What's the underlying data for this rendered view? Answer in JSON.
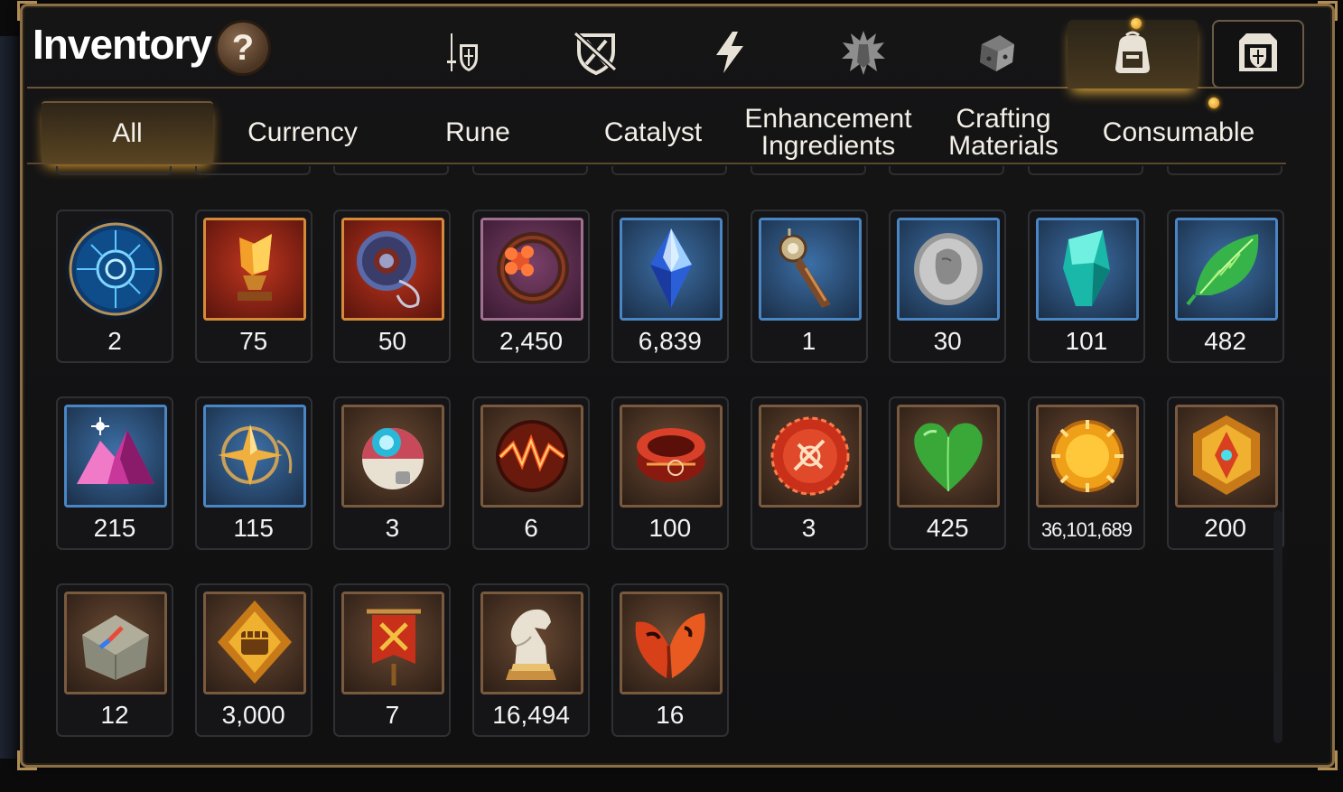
{
  "title": "Inventory",
  "help_label": "?",
  "top_tabs": [
    {
      "name": "tab-equipment",
      "icon": "sword-shield-icon",
      "active": false
    },
    {
      "name": "tab-artifact",
      "icon": "crossed-shield-icon",
      "active": false
    },
    {
      "name": "tab-skill",
      "icon": "lightning-icon",
      "active": false
    },
    {
      "name": "tab-catalyst",
      "icon": "spiky-crest-icon",
      "active": false
    },
    {
      "name": "tab-crafting",
      "icon": "dice-icon",
      "active": false
    },
    {
      "name": "tab-inventory",
      "icon": "backpack-icon",
      "active": true
    },
    {
      "name": "tab-guild",
      "icon": "castle-shield-icon",
      "active": false
    }
  ],
  "categories": [
    {
      "label": "All",
      "lines": [
        "All"
      ],
      "active": true
    },
    {
      "label": "Currency",
      "lines": [
        "Currency"
      ],
      "active": false
    },
    {
      "label": "Rune",
      "lines": [
        "Rune"
      ],
      "active": false
    },
    {
      "label": "Catalyst",
      "lines": [
        "Catalyst"
      ],
      "active": false
    },
    {
      "label": "Enhancement Ingredients",
      "lines": [
        "Enhancement",
        "Ingredients"
      ],
      "active": false
    },
    {
      "label": "Crafting Materials",
      "lines": [
        "Crafting",
        "Materials"
      ],
      "active": false
    },
    {
      "label": "Consumable",
      "lines": [
        "Consumable"
      ],
      "active": false
    }
  ],
  "items": [
    {
      "icon": "blue-rune-orb-icon",
      "qty": "2"
    },
    {
      "icon": "golden-crystal-trophy-icon",
      "qty": "75"
    },
    {
      "icon": "blue-ring-pendant-icon",
      "qty": "50"
    },
    {
      "icon": "red-flower-ring-icon",
      "qty": "2,450"
    },
    {
      "icon": "blue-crystal-icon",
      "qty": "6,839"
    },
    {
      "icon": "compass-pendulum-icon",
      "qty": "1"
    },
    {
      "icon": "silver-coin-icon",
      "qty": "30"
    },
    {
      "icon": "teal-crystal-icon",
      "qty": "101"
    },
    {
      "icon": "green-leaf-icon",
      "qty": "482"
    },
    {
      "icon": "pink-crystal-pile-icon",
      "qty": "215"
    },
    {
      "icon": "star-amulet-icon",
      "qty": "115"
    },
    {
      "icon": "robot-capsule-icon",
      "qty": "3"
    },
    {
      "icon": "red-energy-orb-icon",
      "qty": "6"
    },
    {
      "icon": "red-bracelet-icon",
      "qty": "100"
    },
    {
      "icon": "red-seal-badge-icon",
      "qty": "3"
    },
    {
      "icon": "green-heart-icon",
      "qty": "425"
    },
    {
      "icon": "gold-coin-icon",
      "qty": "36,101,689"
    },
    {
      "icon": "gold-emblem-icon",
      "qty": "200"
    },
    {
      "icon": "stone-compass-icon",
      "qty": "12"
    },
    {
      "icon": "fist-badge-icon",
      "qty": "3,000"
    },
    {
      "icon": "red-banner-icon",
      "qty": "7"
    },
    {
      "icon": "knight-chess-icon",
      "qty": "16,494"
    },
    {
      "icon": "red-leaf-icon",
      "qty": "16"
    }
  ],
  "colors": {
    "accent_gold": "#e7a32f",
    "frame_border": "#8a6e45",
    "blue_slot": "#2d5b8c",
    "brown_slot": "#5a3f2c",
    "red_slot": "#a02a1c",
    "purple_slot": "#6a3456"
  }
}
